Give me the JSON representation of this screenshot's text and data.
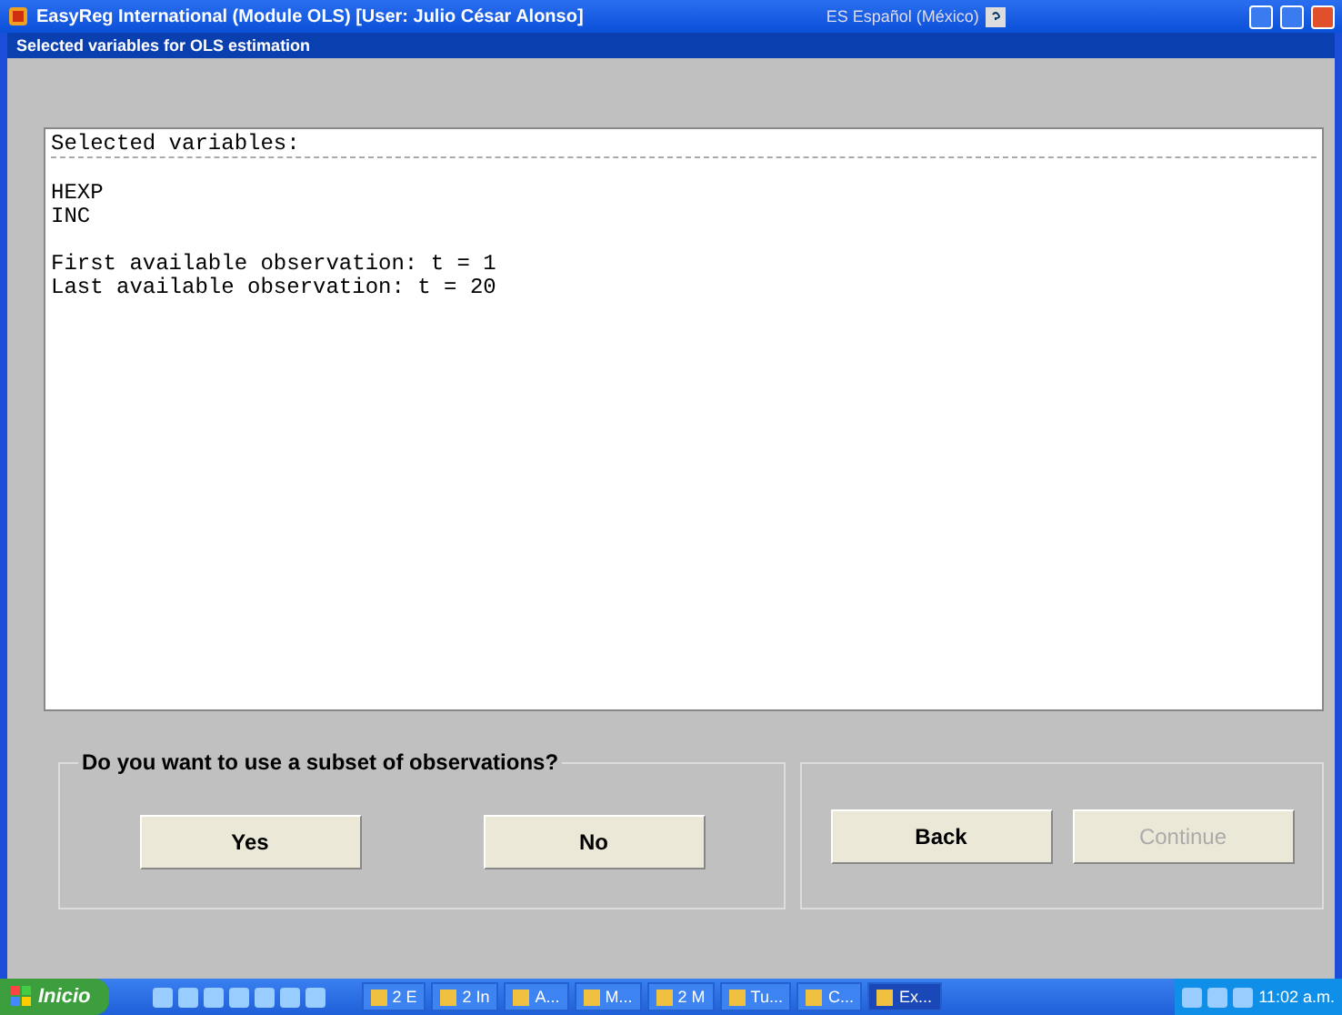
{
  "window": {
    "title": "EasyReg International (Module OLS) [User: Julio César Alonso]",
    "language": "ES Español (México)"
  },
  "dialog": {
    "title": "Selected variables for OLS estimation"
  },
  "output": {
    "header": "Selected variables:",
    "variables": [
      "HEXP",
      "INC"
    ],
    "observations": [
      "First available observation: t = 1",
      "Last available observation: t = 20"
    ]
  },
  "question": {
    "label": "Do you want to use a subset of observations?",
    "buttons": [
      {
        "label": "Yes",
        "disabled": false
      },
      {
        "label": "No",
        "disabled": false
      }
    ]
  },
  "navigation": {
    "buttons": [
      {
        "label": "Back",
        "disabled": false
      },
      {
        "label": "Continue",
        "disabled": true
      }
    ]
  },
  "taskbar": {
    "start": "Inicio",
    "tasks": [
      {
        "label": "2 E",
        "selected": false
      },
      {
        "label": "2 In",
        "selected": false
      },
      {
        "label": "A...",
        "selected": false
      },
      {
        "label": "M...",
        "selected": false
      },
      {
        "label": "2 M",
        "selected": false
      },
      {
        "label": "Tu...",
        "selected": false
      },
      {
        "label": "C...",
        "selected": false
      },
      {
        "label": "Ex...",
        "selected": true
      }
    ],
    "clock": "11:02 a.m."
  }
}
